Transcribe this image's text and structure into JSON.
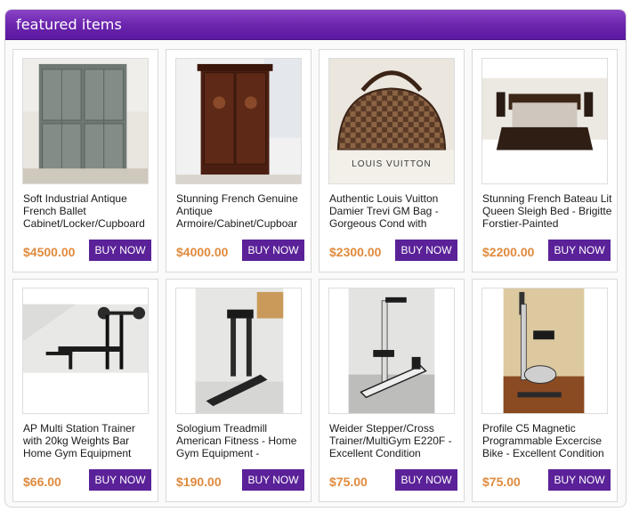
{
  "header": {
    "title": "featured items"
  },
  "buy_label": "BUY NOW",
  "colors": {
    "header": "#6a23ad",
    "button": "#5a2198",
    "price": "#e08a3c"
  },
  "items": [
    {
      "title": "Soft Industrial Antique French Ballet Cabinet/Locker/Cupboard",
      "price": "$4500.00",
      "image": "grey-locker-cabinet"
    },
    {
      "title": "Stunning French Genuine Antique Armoire/Cabinet/Cupboar",
      "price": "$4000.00",
      "image": "wooden-armoire"
    },
    {
      "title": "Authentic Louis Vuitton Damier Trevi GM Bag - Gorgeous Cond with",
      "price": "$2300.00",
      "image": "louis-vuitton-bag"
    },
    {
      "title": "Stunning French Bateau Lit Queen Sleigh Bed - Brigitte Forstier-Painted",
      "price": "$2200.00",
      "image": "sleigh-bed"
    },
    {
      "title": "AP Multi Station Trainer with 20kg Weights Bar Home Gym Equipment",
      "price": "$66.00",
      "image": "weight-bench"
    },
    {
      "title": "Sologium Treadmill American Fitness - Home Gym Equipment -",
      "price": "$190.00",
      "image": "treadmill"
    },
    {
      "title": "Weider Stepper/Cross Trainer/MultiGym E220F - Excellent Condition",
      "price": "$75.00",
      "image": "multigym"
    },
    {
      "title": "Profile C5 Magnetic Programmable Excercise Bike - Excellent Condition",
      "price": "$75.00",
      "image": "exercise-bike"
    }
  ],
  "bag_logo_text": "LOUIS VUITTON"
}
